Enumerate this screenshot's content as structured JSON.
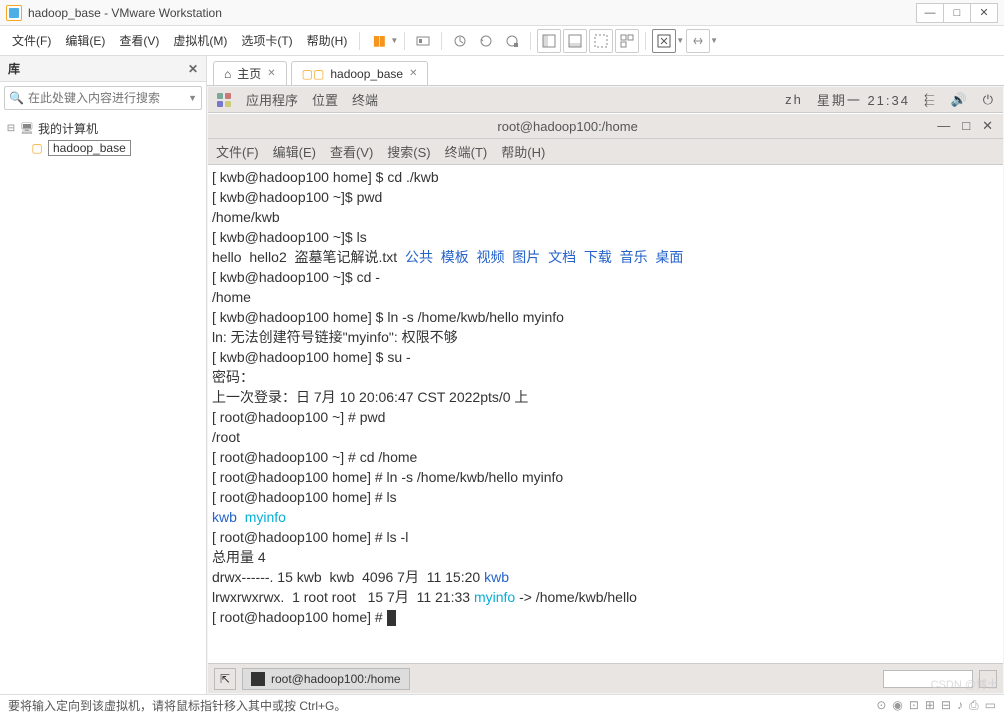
{
  "window": {
    "title": "hadoop_base - VMware Workstation"
  },
  "menu": {
    "file": "文件(F)",
    "edit": "编辑(E)",
    "view": "查看(V)",
    "vm": "虚拟机(M)",
    "tabs": "选项卡(T)",
    "help": "帮助(H)"
  },
  "sidebar": {
    "title": "库",
    "search_placeholder": "在此处键入内容进行搜索",
    "root": "我的计算机",
    "vm": "hadoop_base"
  },
  "tabs": {
    "home": "主页",
    "vm": "hadoop_base"
  },
  "gnome": {
    "apps": "应用程序",
    "places": "位置",
    "terminal": "终端",
    "lang": "zh",
    "clock": "星期一 21:34"
  },
  "term_window": {
    "title": "root@hadoop100:/home",
    "menu": {
      "file": "文件(F)",
      "edit": "编辑(E)",
      "view": "查看(V)",
      "search": "搜索(S)",
      "terminal": "终端(T)",
      "help": "帮助(H)"
    }
  },
  "terminal_lines": [
    {
      "t": "[ kwb@hadoop100 home] $ cd ./kwb"
    },
    {
      "t": "[ kwb@hadoop100 ~]$ pwd"
    },
    {
      "t": "/home/kwb"
    },
    {
      "t": "[ kwb@hadoop100 ~]$ ls"
    },
    {
      "parts": [
        {
          "t": "hello  hello2  盗墓笔记解说.txt  "
        },
        {
          "t": "公共  模板  视频  图片  文档  下载  音乐  桌面",
          "c": "blue"
        }
      ]
    },
    {
      "t": "[ kwb@hadoop100 ~]$ cd -"
    },
    {
      "t": "/home"
    },
    {
      "t": "[ kwb@hadoop100 home] $ ln -s /home/kwb/hello myinfo"
    },
    {
      "t": "ln: 无法创建符号链接\"myinfo\": 权限不够"
    },
    {
      "t": "[ kwb@hadoop100 home] $ su -"
    },
    {
      "t": "密码："
    },
    {
      "t": "上一次登录：日 7月 10 20:06:47 CST 2022pts/0 上"
    },
    {
      "t": "[ root@hadoop100 ~] # pwd"
    },
    {
      "t": "/root"
    },
    {
      "t": "[ root@hadoop100 ~] # cd /home"
    },
    {
      "t": "[ root@hadoop100 home] # ln -s /home/kwb/hello myinfo"
    },
    {
      "t": "[ root@hadoop100 home] # ls"
    },
    {
      "parts": [
        {
          "t": "kwb  ",
          "c": "blue"
        },
        {
          "t": "myinfo",
          "c": "cyan"
        }
      ]
    },
    {
      "t": "[ root@hadoop100 home] # ls -l"
    },
    {
      "t": "总用量 4"
    },
    {
      "parts": [
        {
          "t": "drwx------. 15 kwb  kwb  4096 7月  11 15:20 "
        },
        {
          "t": "kwb",
          "c": "blue"
        }
      ]
    },
    {
      "parts": [
        {
          "t": "lrwxrwxrwx.  1 root root   15 7月  11 21:33 "
        },
        {
          "t": "myinfo",
          "c": "cyan"
        },
        {
          "t": " -> /home/kwb/hello"
        }
      ]
    },
    {
      "parts": [
        {
          "t": "[ root@hadoop100 home] # "
        }
      ],
      "cursor": true
    }
  ],
  "taskbar": {
    "item": "root@hadoop100:/home"
  },
  "status": {
    "text": "要将输入定向到该虚拟机，请将鼠标指针移入其中或按 Ctrl+G。"
  },
  "watermark": "CSDN @博士"
}
